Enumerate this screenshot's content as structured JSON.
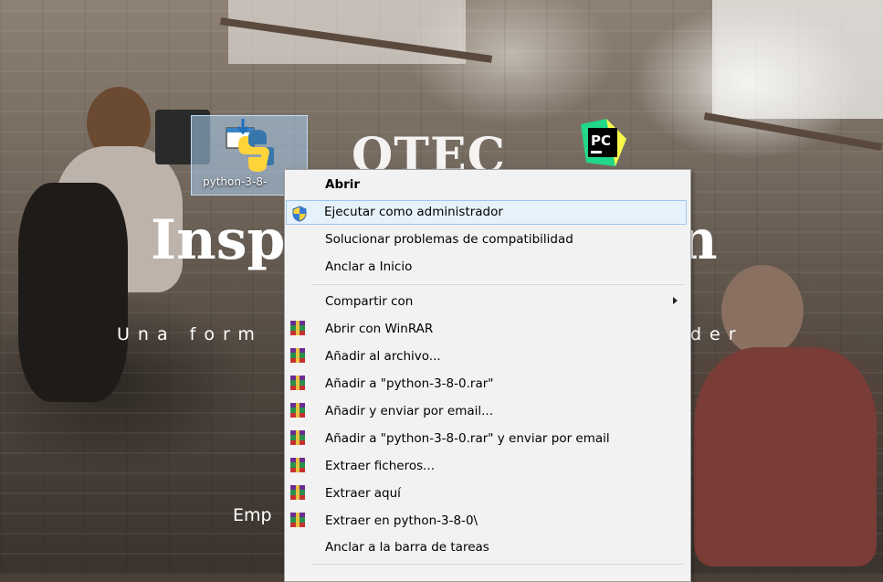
{
  "desktop": {
    "bg_title_1": "OTEC",
    "bg_title_2a": "Inspi",
    "bg_title_2b": "n",
    "bg_subtitle_a": "Una form",
    "bg_subtitle_b": "der",
    "bg_footer": "Emp",
    "icons": [
      {
        "label": "python-3-8-",
        "icon": "python-installer-icon"
      },
      {
        "label": "",
        "icon": "pycharm-icon"
      }
    ]
  },
  "context_menu": {
    "items": [
      {
        "label": "Abrir",
        "icon": null,
        "bold": true
      },
      {
        "label": "Ejecutar como administrador",
        "icon": "shield-icon",
        "highlighted": true
      },
      {
        "label": "Solucionar problemas de compatibilidad",
        "icon": null
      },
      {
        "label": "Anclar a Inicio",
        "icon": null
      },
      {
        "label": "Compartir con",
        "icon": null,
        "submenu": true
      },
      {
        "label": "Abrir con WinRAR",
        "icon": "winrar-icon"
      },
      {
        "label": "Añadir al archivo...",
        "icon": "winrar-icon"
      },
      {
        "label": "Añadir a \"python-3-8-0.rar\"",
        "icon": "winrar-icon"
      },
      {
        "label": "Añadir y enviar por email...",
        "icon": "winrar-icon"
      },
      {
        "label": "Añadir a \"python-3-8-0.rar\" y enviar por email",
        "icon": "winrar-icon"
      },
      {
        "label": "Extraer ficheros...",
        "icon": "winrar-icon"
      },
      {
        "label": "Extraer aquí",
        "icon": "winrar-icon"
      },
      {
        "label": "Extraer en python-3-8-0\\",
        "icon": "winrar-icon"
      },
      {
        "label": "Anclar a la barra de tareas",
        "icon": null
      }
    ]
  },
  "colors": {
    "menu_bg": "#f2f2f2",
    "highlight_bg": "#e5f1fb",
    "highlight_border": "#9cc7ee"
  }
}
